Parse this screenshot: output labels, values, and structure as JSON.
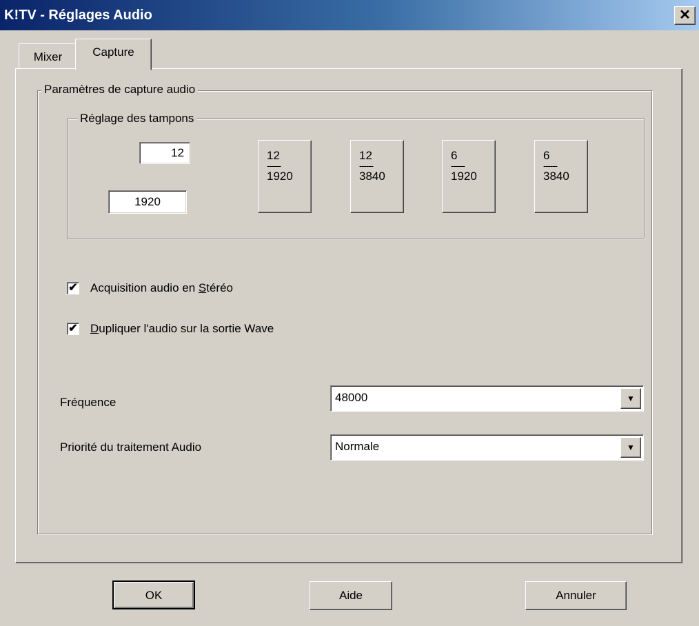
{
  "window": {
    "title": "K!TV - Réglages Audio",
    "close_glyph": "✕"
  },
  "tabs": [
    {
      "label": "Mixer",
      "selected": false
    },
    {
      "label": "Capture",
      "selected": true
    }
  ],
  "capture_group": {
    "title": "Paramètres de capture audio",
    "buffers": {
      "title": "Réglage des tampons",
      "count_value": "12",
      "size_value": "1920",
      "presets": [
        {
          "top": "12",
          "sep": "------",
          "bottom": "1920"
        },
        {
          "top": "12",
          "sep": "------",
          "bottom": "3840"
        },
        {
          "top": "6",
          "sep": "------",
          "bottom": "1920"
        },
        {
          "top": "6",
          "sep": "------",
          "bottom": "3840"
        }
      ]
    },
    "stereo": {
      "pre": "Acquisition audio en ",
      "accel": "S",
      "post": "téréo",
      "checked": true
    },
    "duplicate": {
      "pre": "",
      "accel": "D",
      "post": "upliquer l'audio sur la sortie Wave",
      "checked": true
    },
    "frequency": {
      "label": "Fréquence",
      "value": "48000"
    },
    "priority": {
      "label": "Priorité du traitement Audio",
      "value": "Normale"
    }
  },
  "buttons": {
    "ok": "OK",
    "help": "Aide",
    "cancel": "Annuler"
  },
  "icons": {
    "checkmark": "✔",
    "dropdown_arrow": "▼"
  }
}
